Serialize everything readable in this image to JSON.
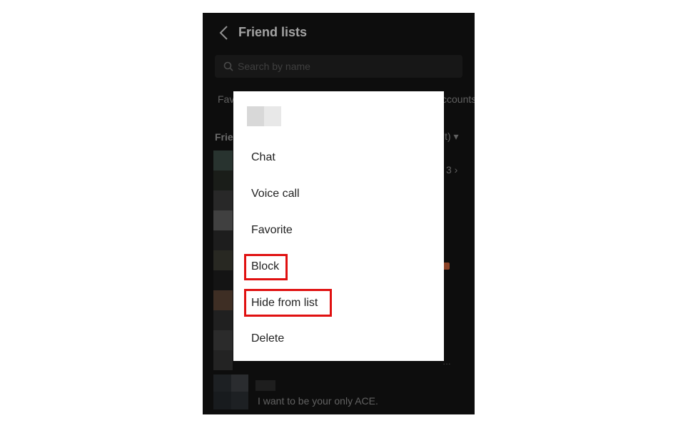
{
  "header": {
    "title": "Friend lists",
    "back_icon": "chevron-left-icon"
  },
  "search": {
    "placeholder": "Search by name",
    "icon": "search-icon"
  },
  "tabs": {
    "left_partial": "Fav",
    "right_partial": "ccounts"
  },
  "section": {
    "label_partial": "Frie",
    "sort_partial": "lt) ▾",
    "count_partial": "3 ›"
  },
  "friends": {
    "truncation": "…",
    "last_status": "I want to be your only ACE."
  },
  "context_menu": {
    "items": [
      {
        "label": "Chat"
      },
      {
        "label": "Voice call"
      },
      {
        "label": "Favorite"
      },
      {
        "label": "Block",
        "highlighted": true
      },
      {
        "label": "Hide from list",
        "highlighted": true
      },
      {
        "label": "Delete"
      }
    ]
  },
  "colors": {
    "highlight": "#e01010",
    "app_background": "#141414",
    "menu_background": "#ffffff"
  }
}
